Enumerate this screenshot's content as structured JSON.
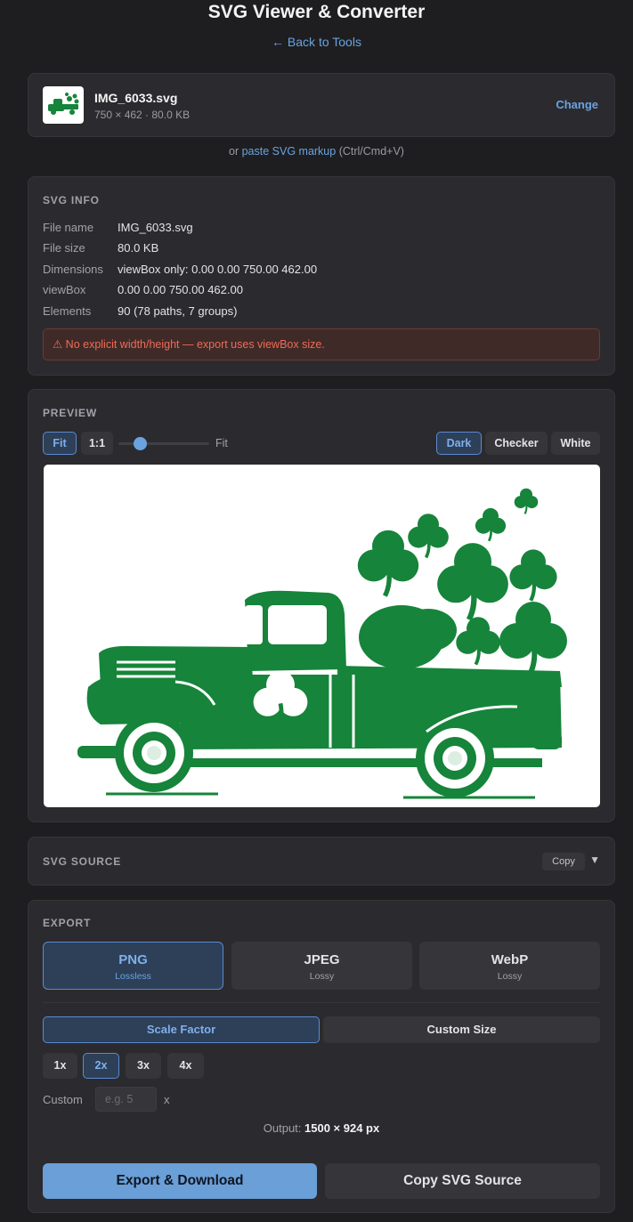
{
  "header": {
    "title": "SVG Viewer & Converter",
    "back_link": "← Back to Tools"
  },
  "file": {
    "name": "IMG_6033.svg",
    "meta": "750 × 462 · 80.0 KB",
    "change_label": "Change"
  },
  "paste": {
    "prefix": "or ",
    "link": "paste SVG markup",
    "suffix": " (Ctrl/Cmd+V)"
  },
  "info": {
    "title": "SVG INFO",
    "rows": [
      {
        "key": "File name",
        "value": "IMG_6033.svg"
      },
      {
        "key": "File size",
        "value": "80.0 KB"
      },
      {
        "key": "Dimensions",
        "value": "viewBox only: 0.00 0.00 750.00 462.00"
      },
      {
        "key": "viewBox",
        "value": "0.00 0.00 750.00 462.00"
      },
      {
        "key": "Elements",
        "value": "90 (78 paths, 7 groups)"
      }
    ],
    "warning": "⚠ No explicit width/height — export uses viewBox size."
  },
  "preview": {
    "title": "PREVIEW",
    "zoom_fit": "Fit",
    "zoom_1to1": "1:1",
    "zoom_level": 0.3,
    "zoom_label": "Fit",
    "bg_dark": "Dark",
    "bg_checker": "Checker",
    "bg_white": "White",
    "image_color": "#16843a"
  },
  "source": {
    "title": "SVG SOURCE",
    "copy_label": "Copy",
    "chevron": "▼"
  },
  "export": {
    "title": "EXPORT",
    "formats": [
      {
        "name": "PNG",
        "sub": "Lossless"
      },
      {
        "name": "JPEG",
        "sub": "Lossy"
      },
      {
        "name": "WebP",
        "sub": "Lossy"
      }
    ],
    "mode_scale": "Scale Factor",
    "mode_custom": "Custom Size",
    "scales": [
      "1x",
      "2x",
      "3x",
      "4x"
    ],
    "custom_label": "Custom",
    "custom_placeholder": "e.g. 5",
    "custom_suffix": "x",
    "output_label": "Output: ",
    "output_value": "1500 × 924 px",
    "export_button": "Export & Download",
    "copy_source_button": "Copy SVG Source"
  },
  "colors": {
    "accent": "#6aa3e0",
    "warning": "#ef6b57",
    "truck_green": "#16843a"
  }
}
